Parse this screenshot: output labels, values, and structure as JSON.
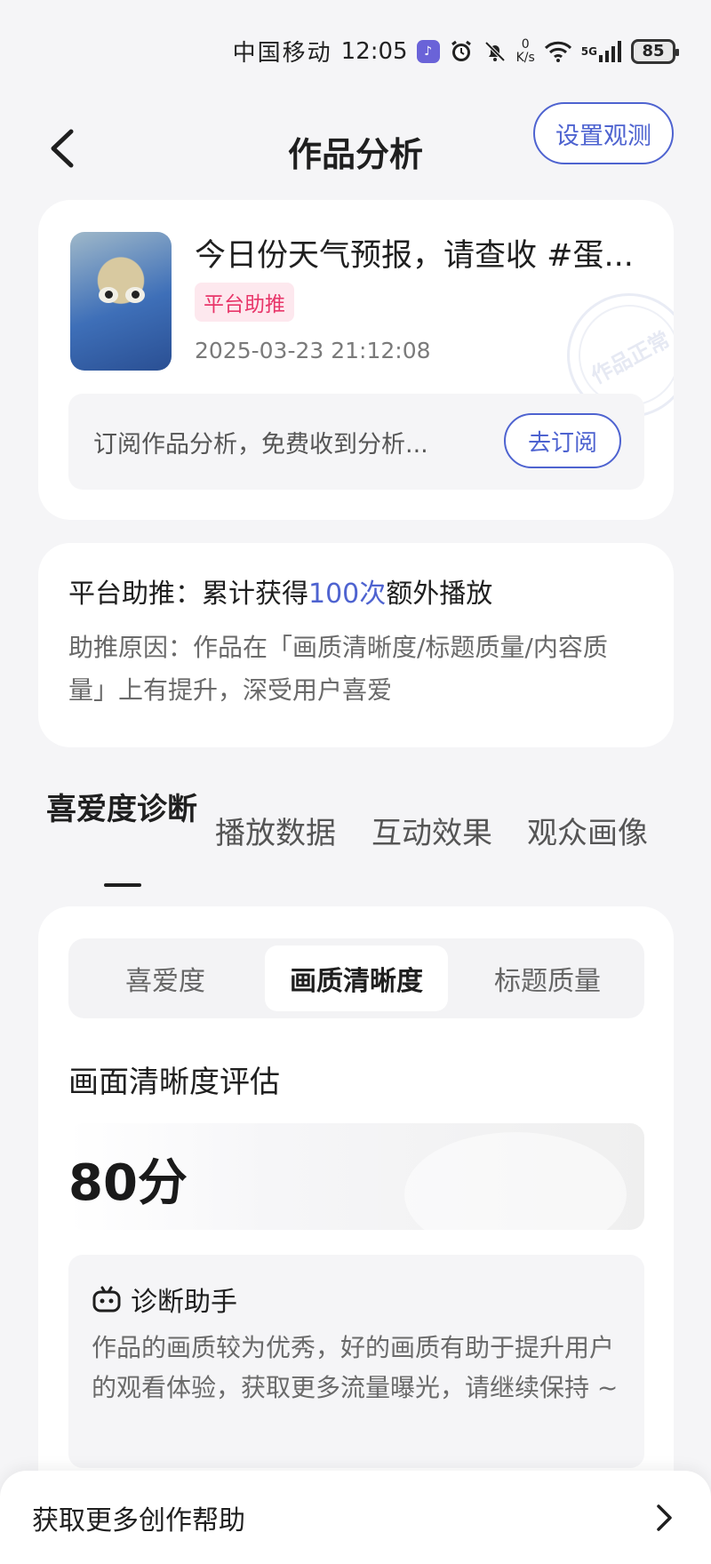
{
  "status_bar": {
    "carrier": "中国移动",
    "time": "12:05",
    "net_speed_value": "0",
    "net_speed_unit": "K/s",
    "network": "5G",
    "battery": "85"
  },
  "nav": {
    "title": "作品分析",
    "observe_button": "设置观测"
  },
  "work": {
    "title": "今日份天气预报，请查收 #蛋...",
    "tag": "平台助推",
    "date": "2025-03-23 21:12:08",
    "stamp": "作品正常",
    "subscribe_text": "订阅作品分析，免费收到分析...",
    "subscribe_button": "去订阅"
  },
  "boost": {
    "prefix": "平台助推：累计获得",
    "highlight": "100次",
    "suffix": "额外播放",
    "reason": "助推原因：作品在「画质清晰度/标题质量/内容质量」上有提升，深受用户喜爱"
  },
  "tabs": [
    {
      "label": "喜爱度诊断"
    },
    {
      "label": "播放数据"
    },
    {
      "label": "互动效果"
    },
    {
      "label": "观众画像"
    }
  ],
  "segments": [
    {
      "label": "喜爱度"
    },
    {
      "label": "画质清晰度"
    },
    {
      "label": "标题质量"
    }
  ],
  "evaluation": {
    "title": "画面清晰度评估",
    "score": "80分"
  },
  "assistant": {
    "title": "诊断助手",
    "text": "作品的画质较为优秀，好的画质有助于提升用户的观看体验，获取更多流量曝光，请继续保持 ~"
  },
  "footer": {
    "label": "获取更多创作帮助"
  },
  "colors": {
    "accent": "#4e63d0",
    "tag": "#e8366a"
  }
}
